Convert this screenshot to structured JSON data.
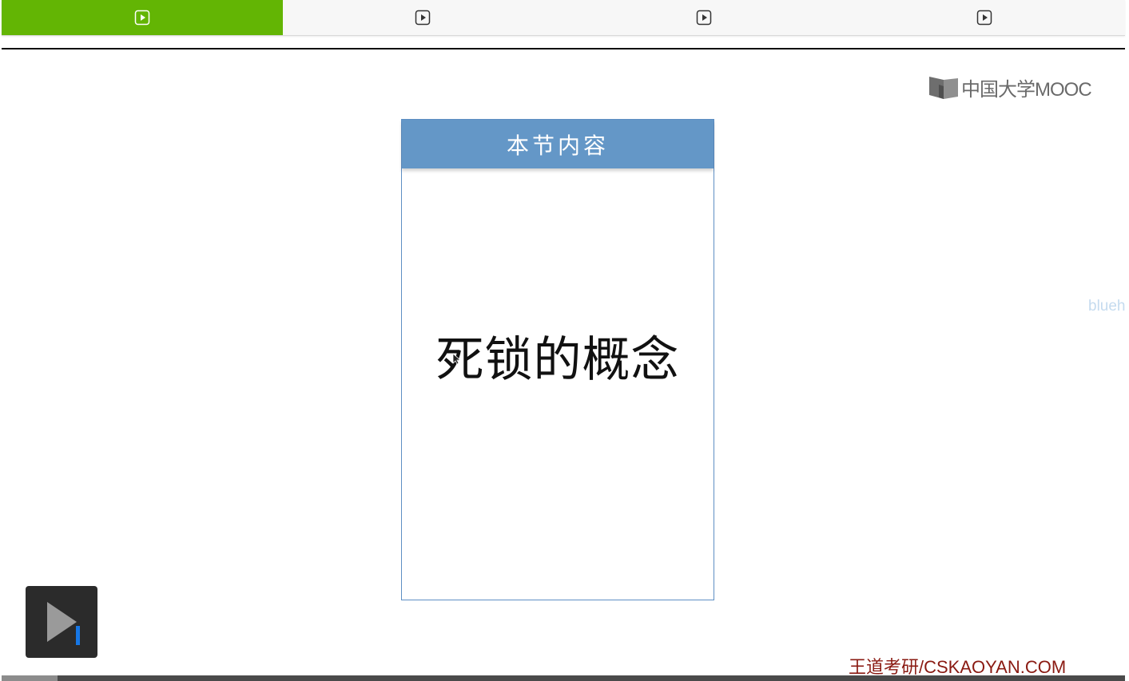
{
  "tabs": [
    {
      "icon": "play-square-icon",
      "active": true
    },
    {
      "icon": "play-square-icon",
      "active": false
    },
    {
      "icon": "play-square-icon",
      "active": false
    },
    {
      "icon": "play-square-icon",
      "active": false
    }
  ],
  "colors": {
    "tab_active": "#63b504",
    "card_header": "#6497c7",
    "footer_brand": "#8a1a12"
  },
  "logo": {
    "text": "中国大学MOOC"
  },
  "slide": {
    "header": "本节内容",
    "topic": "死锁的概念"
  },
  "watermark": "blueh",
  "footer": {
    "brand": "王道考研/CSKAOYAN.COM"
  },
  "player": {
    "progress_fraction": 0.05
  }
}
